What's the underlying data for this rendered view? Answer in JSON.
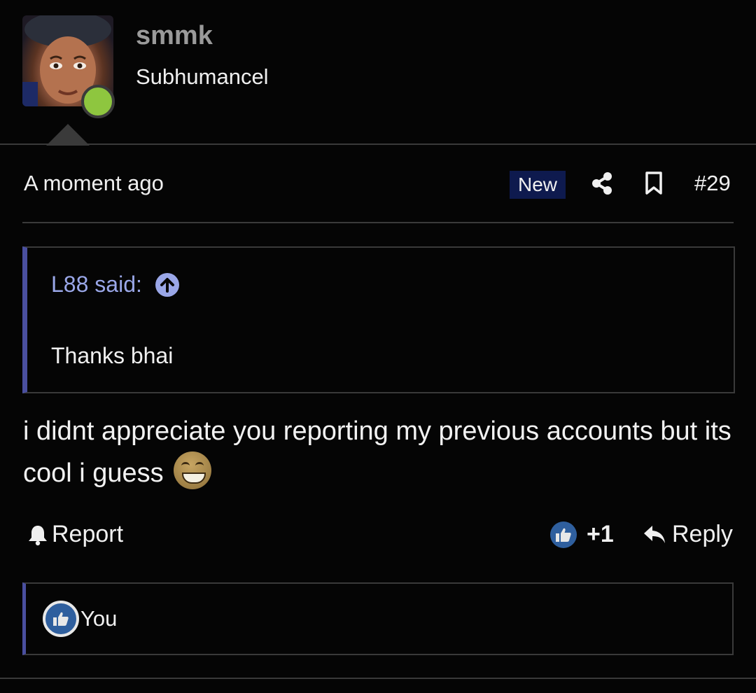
{
  "author": {
    "username": "smmk",
    "title": "Subhumancel",
    "status": "online",
    "status_color": "#8ec63f"
  },
  "post": {
    "timestamp": "A moment ago",
    "new_badge": "New",
    "number": "#29",
    "icons": {
      "share": "share-icon",
      "bookmark": "bookmark-icon"
    }
  },
  "quote": {
    "author": "L88 said:",
    "jump_icon": "arrow-up-circle-icon",
    "text": "Thanks bhai"
  },
  "message": {
    "text": "i didnt appreciate you reporting my previous accounts but its cool i guess",
    "emoji": "laughing-with-tears-icon"
  },
  "actions": {
    "report_label": "Report",
    "reaction_count": "+1",
    "reply_label": "Reply"
  },
  "reactions": {
    "users": [
      "You"
    ],
    "icon": "thumbs-up-icon"
  },
  "colors": {
    "background": "#050505",
    "accent": "#4a4fa0",
    "quote_author": "#9aa7e8",
    "new_badge_bg": "#0e1a4e",
    "like": "#2f5f9e"
  }
}
